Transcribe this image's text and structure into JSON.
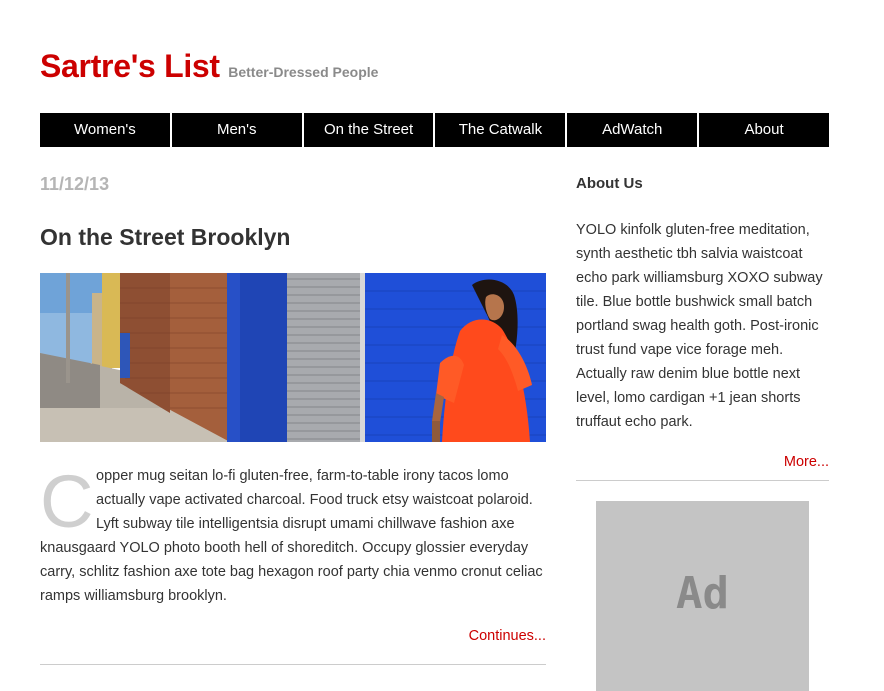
{
  "site": {
    "title": "Sartre's List",
    "tagline": "Better-Dressed People"
  },
  "nav": {
    "items": [
      "Women's",
      "Men's",
      "On the Street",
      "The Catwalk",
      "AdWatch",
      "About"
    ]
  },
  "post": {
    "date": "11/12/13",
    "title": "On the Street Brooklyn",
    "dropcap": "C",
    "body": "opper mug seitan lo-fi gluten-free, farm-to-table irony tacos lomo actually vape activated charcoal. Food truck etsy waistcoat polaroid. Lyft subway tile intelligentsia disrupt umami chillwave fashion axe knausgaard YOLO photo booth hell of shoreditch. Occupy glossier everyday carry, schlitz fashion axe tote bag hexagon roof party chia venmo cronut celiac ramps williamsburg brooklyn.",
    "continue_label": "Continues..."
  },
  "sidebar": {
    "heading": "About Us",
    "text": "YOLO kinfolk gluten-free meditation, synth aesthetic tbh salvia waistcoat echo park williamsburg XOXO subway tile. Blue bottle bushwick small batch portland swag health goth. Post-ironic trust fund vape vice forage meh. Actually raw denim blue bottle next level, lomo cardigan +1 jean shorts truffaut echo park.",
    "more_label": "More...",
    "ad_label": "Ad"
  },
  "colors": {
    "accent": "#cc0000",
    "nav_background": "#000000",
    "date": "#b5b5b5",
    "ad_background": "#c4c4c4"
  }
}
